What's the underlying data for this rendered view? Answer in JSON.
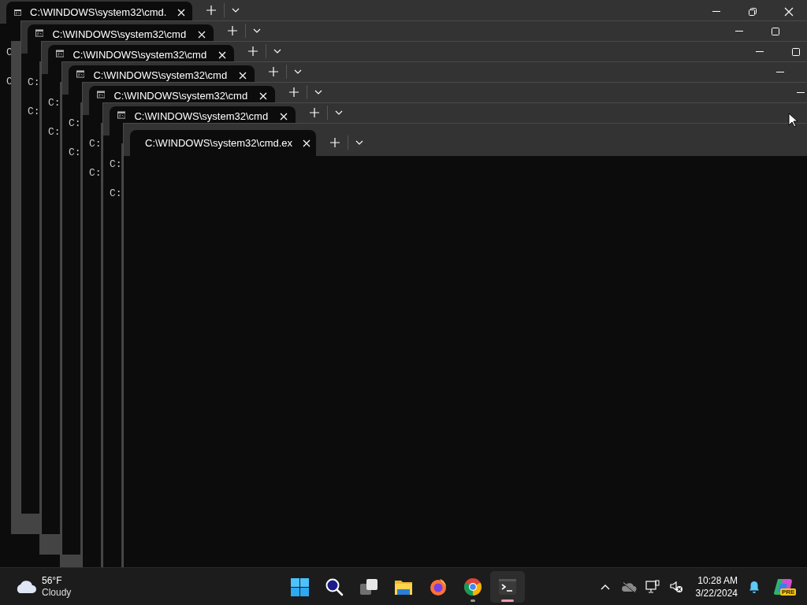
{
  "windows": [
    {
      "tab": {
        "title": "C:\\WINDOWS\\system32\\cmd.",
        "icon": true
      },
      "caption_buttons": [
        {
          "kind": "minimize"
        },
        {
          "kind": "restore"
        },
        {
          "kind": "close"
        }
      ],
      "lines": [
        "C",
        "C"
      ]
    },
    {
      "tab": {
        "title": "C:\\WINDOWS\\system32\\cmd",
        "icon": true
      },
      "caption_buttons": [
        {
          "kind": "minimize"
        },
        {
          "kind": "maximize"
        }
      ],
      "lines": [
        "C:",
        "C:"
      ]
    },
    {
      "tab": {
        "title": "C:\\WINDOWS\\system32\\cmd",
        "icon": true
      },
      "caption_buttons": [
        {
          "kind": "minimize"
        },
        {
          "kind": "maximize"
        }
      ],
      "lines": [
        "C:",
        "C:"
      ]
    },
    {
      "tab": {
        "title": "C:\\WINDOWS\\system32\\cmd",
        "icon": true
      },
      "caption_buttons": [
        {
          "kind": "minimize"
        }
      ],
      "lines": [
        "C:",
        "C:"
      ]
    },
    {
      "tab": {
        "title": "C:\\WINDOWS\\system32\\cmd",
        "icon": true
      },
      "caption_buttons": [
        {
          "kind": "minimize"
        }
      ],
      "lines": [
        "C:",
        "C:"
      ]
    },
    {
      "tab": {
        "title": "C:\\WINDOWS\\system32\\cmd",
        "icon": true
      },
      "lines": [
        "C:",
        "C:"
      ]
    },
    {
      "tab": {
        "title": "C:\\WINDOWS\\system32\\cmd.ex",
        "icon": false
      }
    }
  ],
  "taskbar": {
    "weather": {
      "temperature": "56°F",
      "condition": "Cloudy"
    },
    "apps": [
      {
        "kind": "start",
        "running": false,
        "selected": false
      },
      {
        "kind": "search",
        "running": false,
        "selected": false
      },
      {
        "kind": "task-view",
        "running": false,
        "selected": false
      },
      {
        "kind": "file-explorer",
        "running": false,
        "selected": false
      },
      {
        "kind": "firefox",
        "running": false,
        "selected": false
      },
      {
        "kind": "chrome",
        "running": true,
        "selected": false
      },
      {
        "kind": "terminal",
        "running": true,
        "selected": true
      }
    ],
    "tray": [
      {
        "kind": "chevron"
      },
      {
        "kind": "cloud-off"
      },
      {
        "kind": "network"
      },
      {
        "kind": "volume-muted"
      }
    ],
    "clock": {
      "time": "10:28 AM",
      "date": "3/22/2024"
    },
    "extras": [
      {
        "kind": "bell"
      },
      {
        "kind": "copilot",
        "badge": "PRE"
      }
    ]
  }
}
